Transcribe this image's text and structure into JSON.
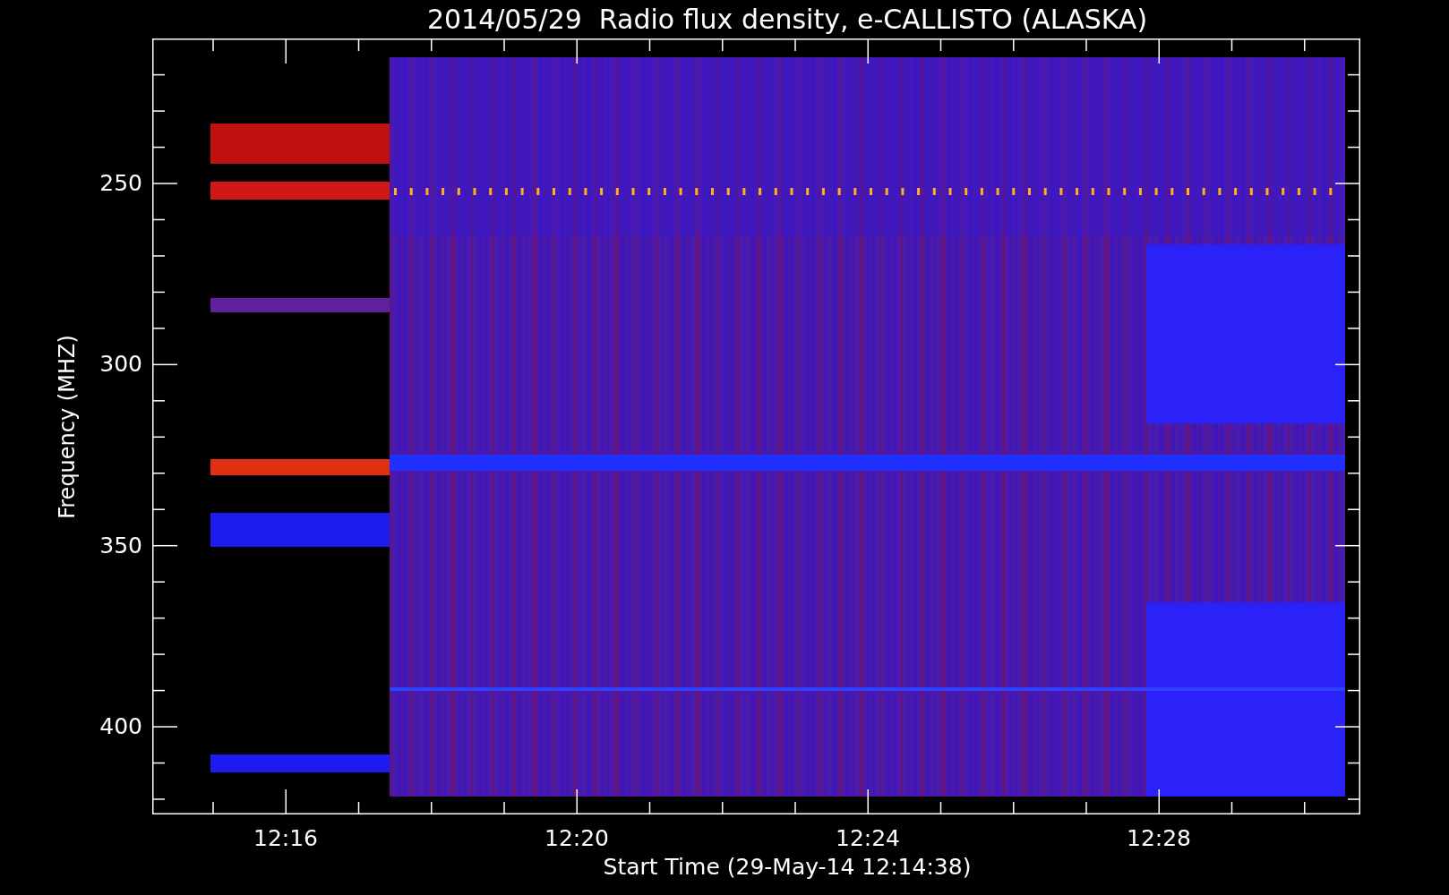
{
  "title": "2014/05/29  Radio flux density, e-CALLISTO (ALASKA)",
  "y_axis": {
    "label": "Frequency (MHZ)",
    "ticks": [
      "250",
      "300",
      "350",
      "400"
    ]
  },
  "x_axis": {
    "label": "Start Time (29-May-14 12:14:38)",
    "ticks": [
      "12:16",
      "12:20",
      "12:24",
      "12:28"
    ]
  }
}
